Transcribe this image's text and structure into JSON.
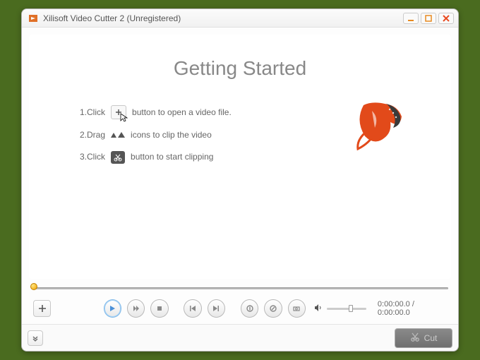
{
  "window": {
    "title": "Xilisoft Video Cutter 2 (Unregistered)"
  },
  "heading": "Getting Started",
  "steps": {
    "s1a": "1.Click",
    "s1b": "button to open a video file.",
    "s2a": "2.Drag",
    "s2b": "icons to clip the video",
    "s3a": "3.Click",
    "s3b": "button to start clipping"
  },
  "playback": {
    "time": "0:00:00.0 / 0:00:00.0"
  },
  "footer": {
    "cut_label": "Cut"
  }
}
